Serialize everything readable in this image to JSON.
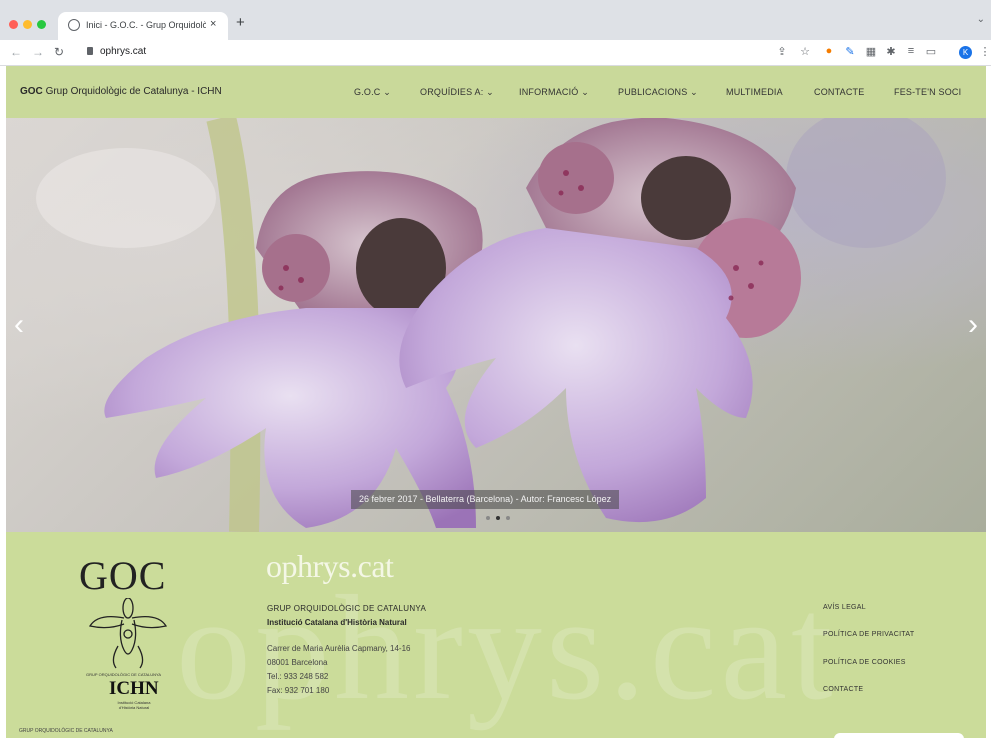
{
  "browser": {
    "tab_title": "Inici - G.O.C. - Grup Orquidològ",
    "new_tab_icon": "+",
    "close_icon": "×",
    "url": "ophrys.cat",
    "profile_initial": "K"
  },
  "header": {
    "brand_bold": "GOC",
    "brand_rest": "Grup Orquidològic de Catalunya - ICHN",
    "menu": [
      {
        "label": "G.O.C ⌄"
      },
      {
        "label": "ORQUÍDIES A: ⌄"
      },
      {
        "label": "INFORMACIÓ ⌄"
      },
      {
        "label": "PUBLICACIONS ⌄"
      },
      {
        "label": "MULTIMEDIA"
      },
      {
        "label": "CONTACTE"
      },
      {
        "label": "FES-TE'N SOCI"
      }
    ]
  },
  "hero": {
    "caption": "26 febrer 2017 - Bellaterra (Barcelona) - Autor: Francesc López",
    "prev_icon": "‹",
    "next_icon": "›",
    "active_slide": 2,
    "slide_count": 3
  },
  "footer": {
    "logo_text": "GOC",
    "logo_subtext": "GRUP ORQUIDOLÒGIC DE CATALUNYA",
    "ichn": "ICHN",
    "ichn_sub": "Institució Catalana d'Història Natural",
    "site_name": "ophrys.cat",
    "org_name": "GRUP ORQUIDOLÒGIC DE CATALUNYA",
    "institution": "Institució Catalana d'Història Natural",
    "address1": "Carrer de Maria Aurèlia Capmany, 14-16",
    "address2": "08001 Barcelona",
    "tel": "Tel.: 933 248 582",
    "fax": "Fax: 932 701 180",
    "bottom_text": "GRUP ORQUIDOLÒGIC DE CATALUNYA",
    "links": [
      {
        "label": "AVÍS LEGAL"
      },
      {
        "label": "POLÍTICA DE PRIVACITAT"
      },
      {
        "label": "POLÍTICA DE COOKIES"
      },
      {
        "label": "CONTACTE"
      }
    ]
  },
  "colors": {
    "header_bg": "#c9d99a",
    "footer_bg": "#cbdc9a",
    "petal": "#b89ad0",
    "spot": "#8a2a55"
  }
}
